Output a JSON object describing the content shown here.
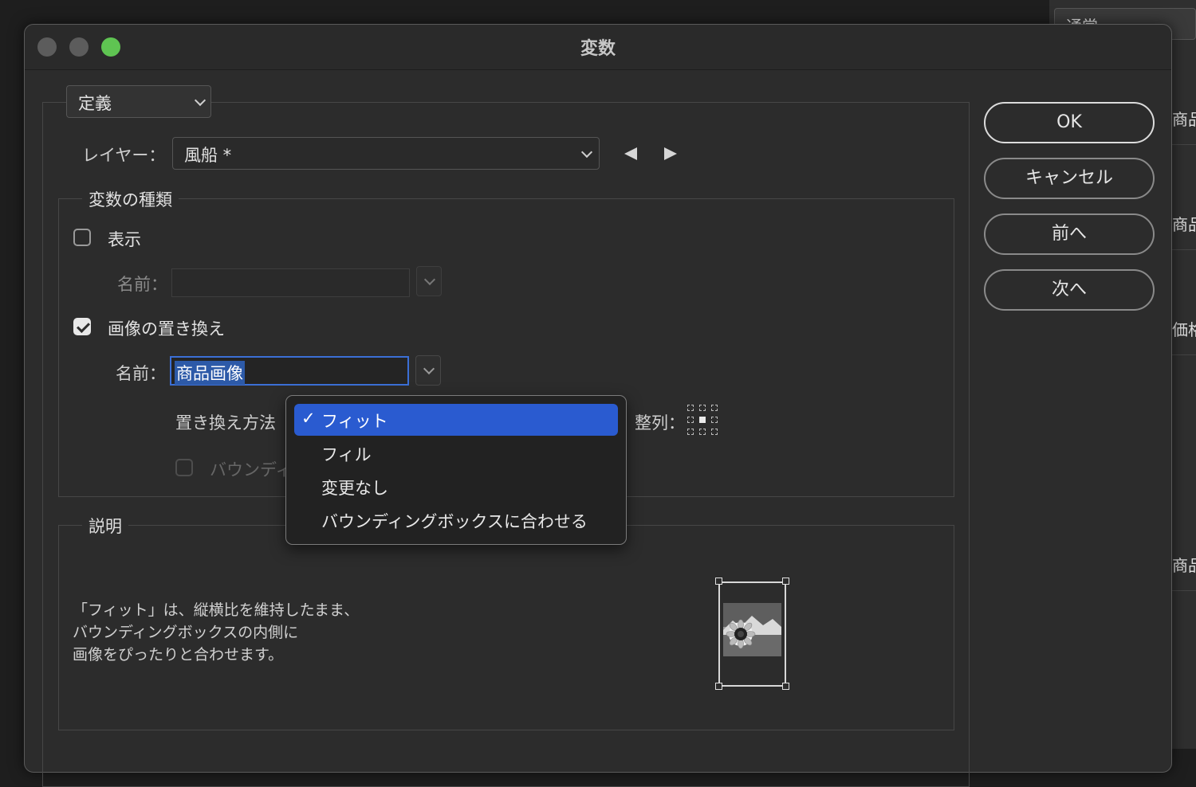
{
  "background": {
    "top_field": "通常",
    "rows": [
      "商品",
      "商品",
      "価格",
      "商品"
    ]
  },
  "window": {
    "title": "変数",
    "traffic_light_colors": {
      "close": "#5c5c5c",
      "minimize": "#5c5c5c",
      "zoom": "#5fc452"
    }
  },
  "mode": {
    "selected": "定義"
  },
  "layer": {
    "label": "レイヤー：",
    "value": "風船 *"
  },
  "variable_types": {
    "title": "変数の種類",
    "visibility": {
      "label": "表示",
      "checked": false,
      "name_label": "名前：",
      "name_value": ""
    },
    "image_replace": {
      "label": "画像の置き換え",
      "checked": true,
      "name_label": "名前：",
      "name_value": "商品画像",
      "method_label": "置き換え方法",
      "align_label": "整列：",
      "bounding_label": "バウンディ"
    }
  },
  "method_menu": {
    "items": [
      {
        "label": "フィット",
        "selected": true
      },
      {
        "label": "フィル",
        "selected": false
      },
      {
        "label": "変更なし",
        "selected": false
      },
      {
        "label": "バウンディングボックスに合わせる",
        "selected": false
      }
    ],
    "check_glyph": "✓"
  },
  "description": {
    "title": "説明",
    "lines": [
      "「フィット」は、縦横比を維持したまま、",
      "バウンディングボックスの内側に",
      "画像をぴったりと合わせます。"
    ]
  },
  "buttons": {
    "ok": "OK",
    "cancel": "キャンセル",
    "prev": "前へ",
    "next": "次へ"
  },
  "colors": {
    "accent": "#2a5bd0",
    "focus_ring": "#3b6fd6"
  }
}
